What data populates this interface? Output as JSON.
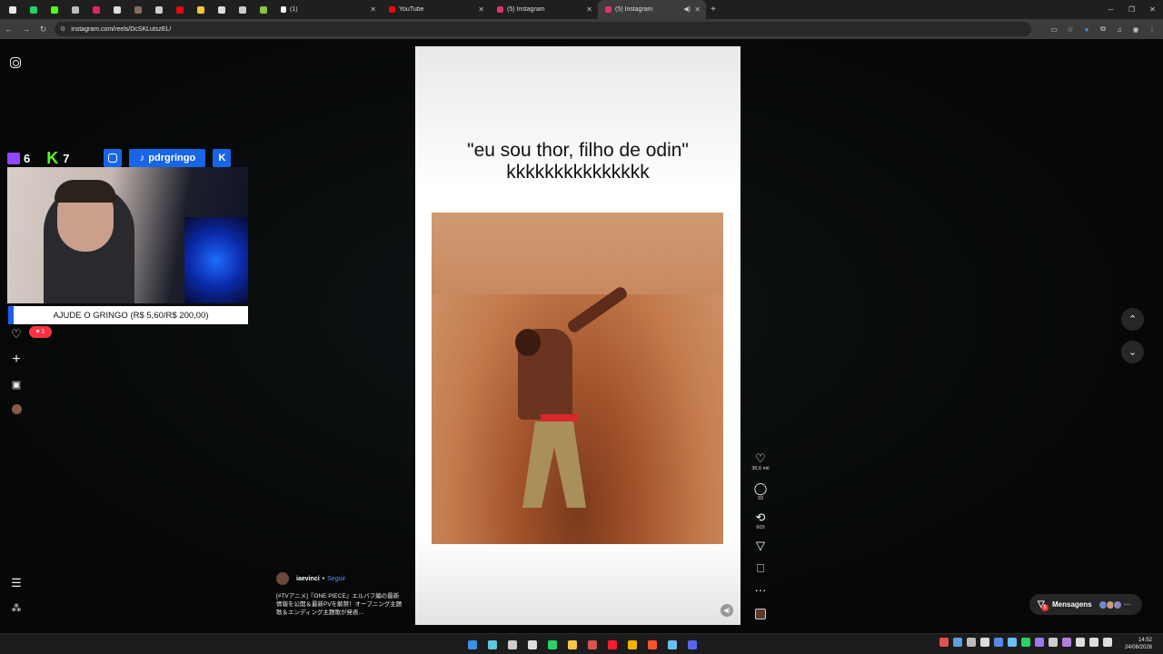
{
  "browser": {
    "pinned_tabs": [
      {
        "icon": "chat-icon",
        "color": "#e8e8e8"
      },
      {
        "icon": "whatsapp-icon",
        "color": "#25d366"
      },
      {
        "icon": "kick-icon",
        "color": "#53fc18"
      },
      {
        "icon": "mute-icon",
        "color": "#bbbbbb"
      },
      {
        "icon": "record-icon",
        "color": "#e0245e"
      },
      {
        "icon": "app-icon",
        "color": "#dddddd"
      },
      {
        "icon": "avatar-icon",
        "color": "#8a6a5a"
      },
      {
        "icon": "gear-icon",
        "color": "#cccccc"
      },
      {
        "icon": "netflix-icon",
        "color": "#e50914"
      },
      {
        "icon": "notes-icon",
        "color": "#f4c542"
      },
      {
        "icon": "google-icon",
        "color": "#dddddd"
      },
      {
        "icon": "anchor-icon",
        "color": "#cccccc"
      },
      {
        "icon": "android-icon",
        "color": "#8bc34a"
      }
    ],
    "tabs": [
      {
        "label": "(1)",
        "favicon": "tiktok-icon",
        "color": "#ffffff",
        "active": false
      },
      {
        "label": "YouTube",
        "favicon": "youtube-icon",
        "color": "#ff0000",
        "active": false
      },
      {
        "label": "(5) Instagram",
        "favicon": "instagram-icon",
        "color": "#e1306c",
        "active": false
      },
      {
        "label": "(5) Instagram",
        "favicon": "instagram-icon",
        "color": "#e1306c",
        "active": true
      }
    ],
    "url": "instagram.com/reels/DcSKLutszEL/"
  },
  "stream_overlay": {
    "twitch_count": "6",
    "kick_count": "7",
    "tiktok_handle": "pdrgringo",
    "donation_goal": "AJUDE O GRINGO (R$ 5,60/R$ 200,00)"
  },
  "sidebar": {
    "notification_badge": "1"
  },
  "reel": {
    "caption_line1": "\"eu sou thor, filho de odin\"",
    "caption_line2": "kkkkkkkkkkkkkkk",
    "author": "iaevinci",
    "separator": "•",
    "follow_label": "Seguir",
    "description": "[#TVアニメ]『ONE PIECE』エルバフ編の最新情報を公開＆最新PVを解禁！オープニング主題歌＆エンディング主題歌が発表..."
  },
  "actions": {
    "likes": "36,6 mil",
    "comments": "93",
    "reposts": "603",
    "more": "···"
  },
  "messages": {
    "label": "Mensagens",
    "badge": "5"
  },
  "taskbar": {
    "time": "14:52",
    "date": "24/08/2026",
    "apps": [
      {
        "icon": "start-icon",
        "color": "#3b8ee8"
      },
      {
        "icon": "app-icon",
        "color": "#5cc8d8"
      },
      {
        "icon": "app-icon",
        "color": "#cccccc"
      },
      {
        "icon": "app-icon",
        "color": "#dddddd"
      },
      {
        "icon": "whatsapp-icon",
        "color": "#25d366"
      },
      {
        "icon": "folder-icon",
        "color": "#f4c542"
      },
      {
        "icon": "app-icon",
        "color": "#d9534f"
      },
      {
        "icon": "opera-icon",
        "color": "#ff1b2d"
      },
      {
        "icon": "chrome-icon",
        "color": "#f4b400"
      },
      {
        "icon": "brave-icon",
        "color": "#fb542b"
      },
      {
        "icon": "steam-icon",
        "color": "#66c0f4"
      },
      {
        "icon": "discord-icon",
        "color": "#5865f2"
      }
    ]
  }
}
